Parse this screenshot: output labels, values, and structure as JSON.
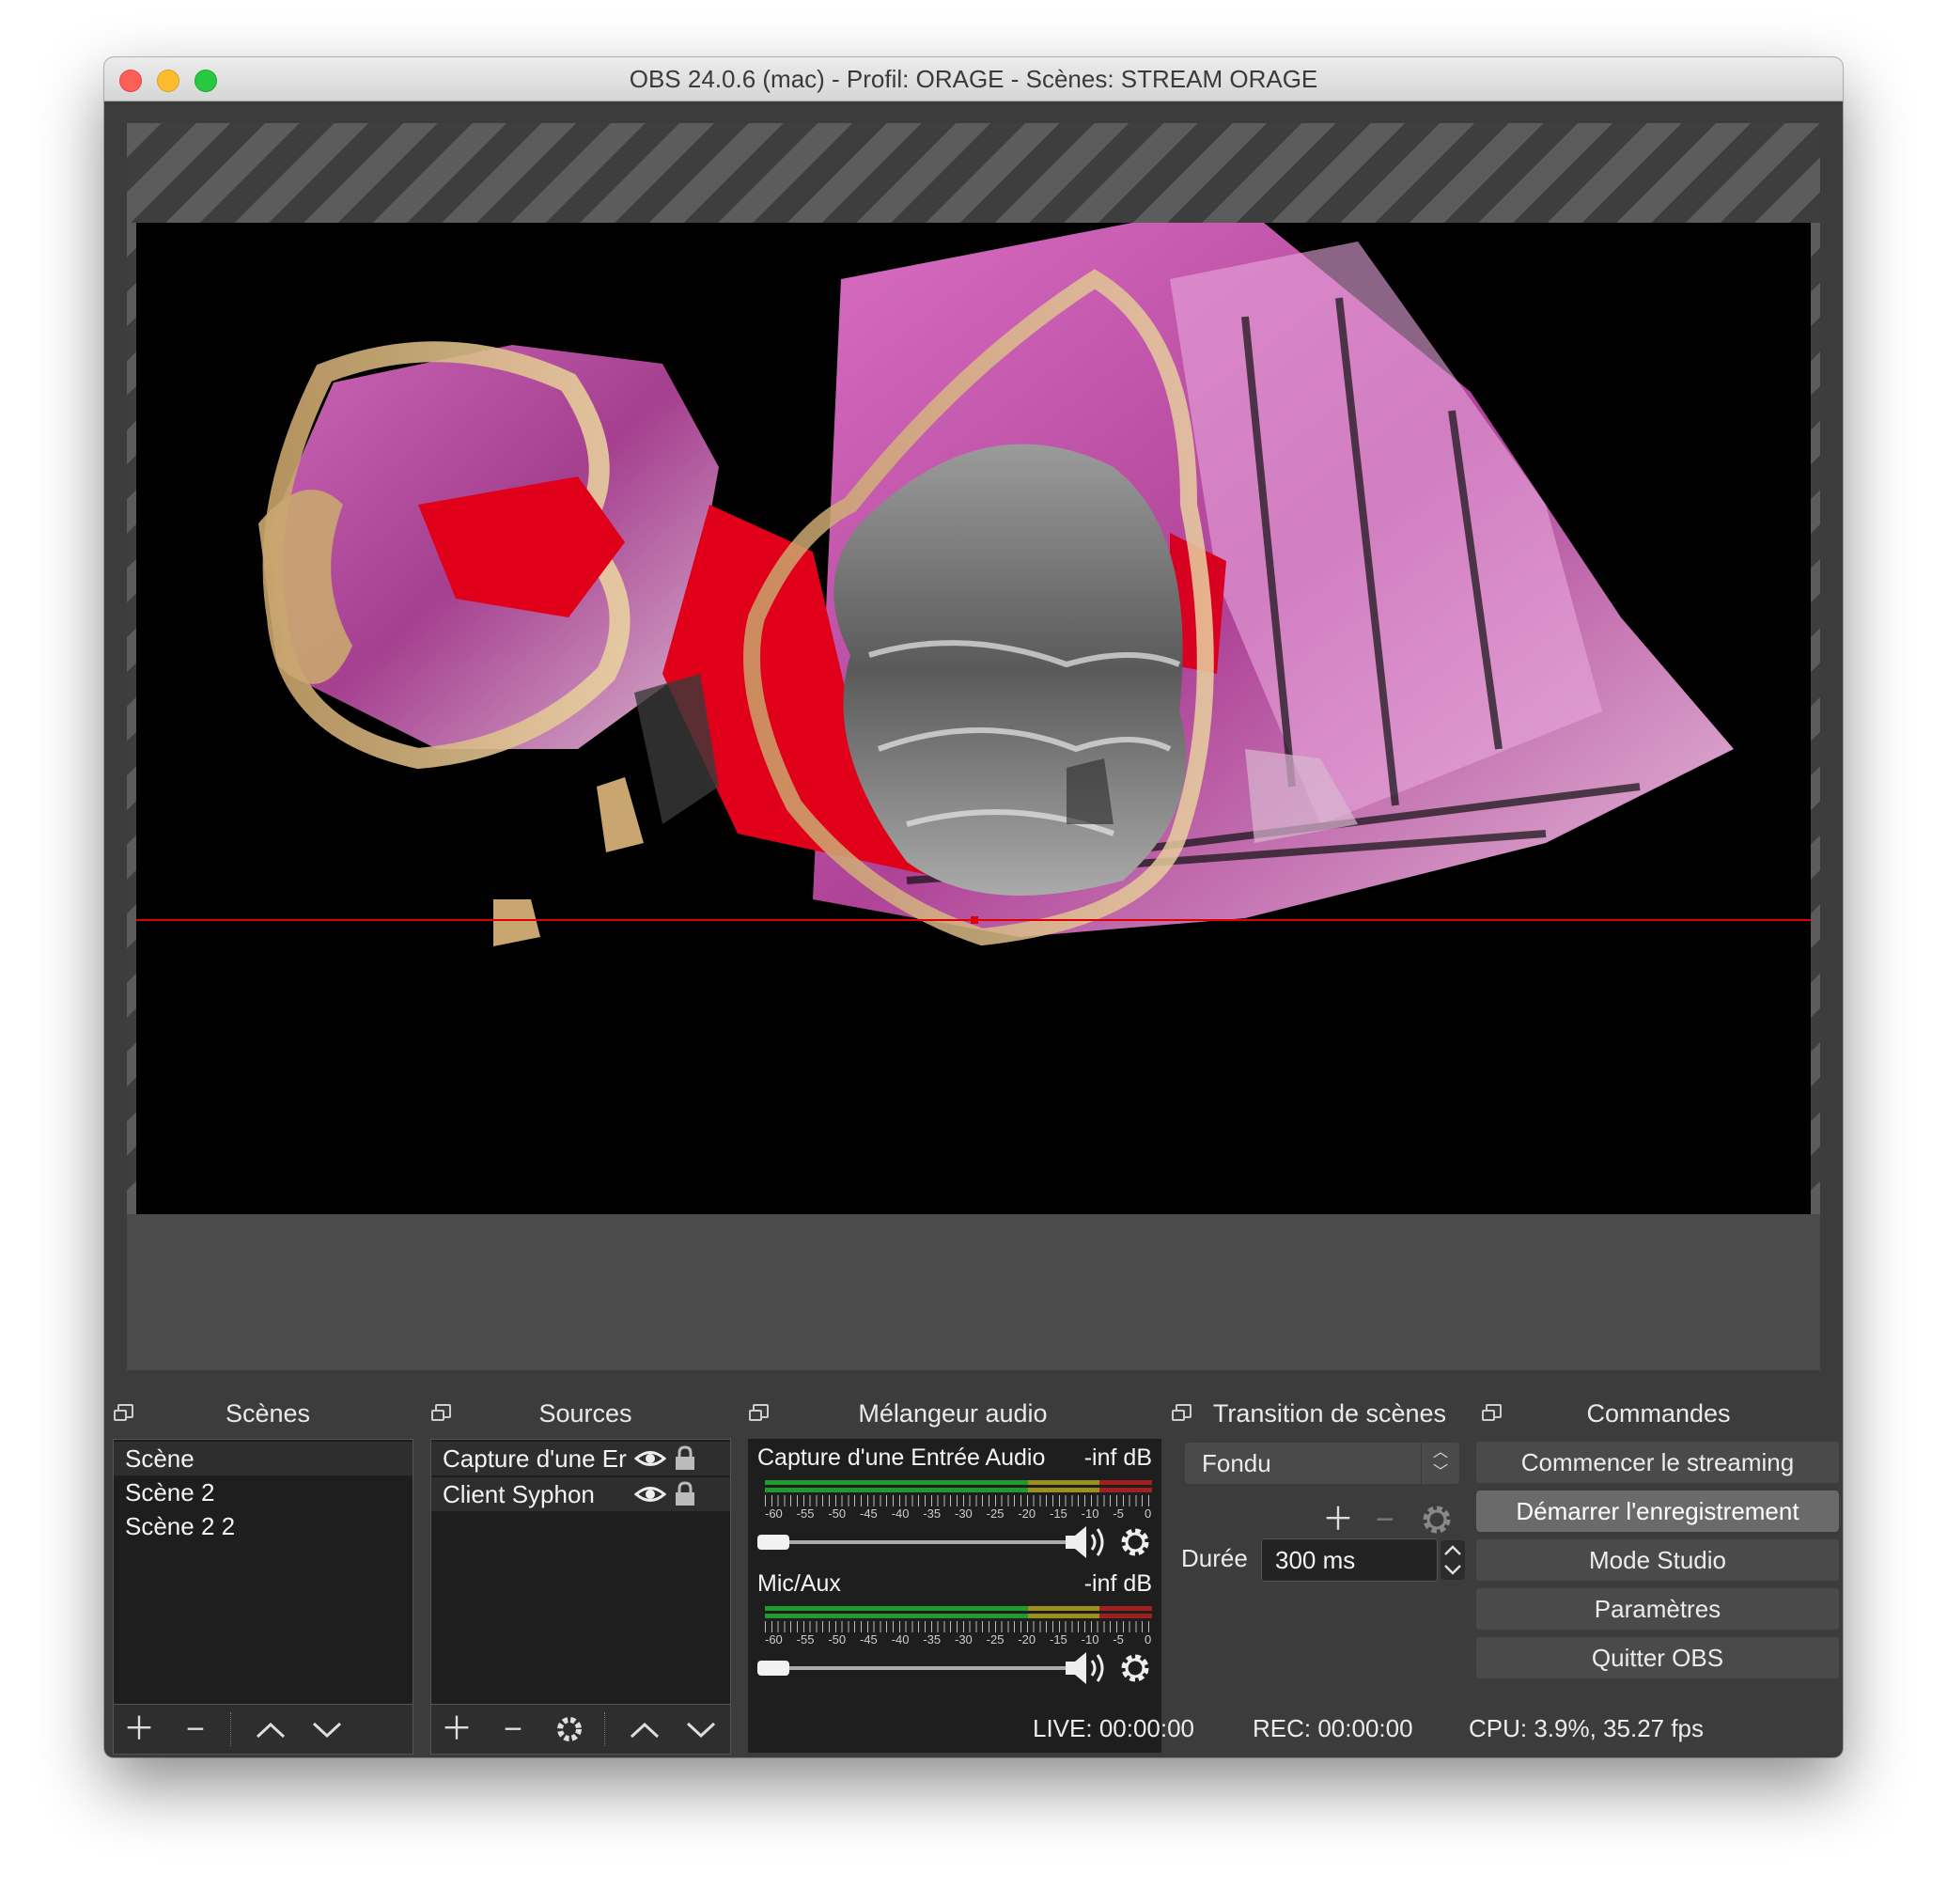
{
  "window": {
    "title": "OBS 24.0.6 (mac) - Profil: ORAGE - Scènes: STREAM ORAGE"
  },
  "docks": {
    "scenes": "Scènes",
    "sources": "Sources",
    "mixer": "Mélangeur audio",
    "transition": "Transition de scènes",
    "controls": "Commandes"
  },
  "scenes": {
    "items": [
      {
        "label": "Scène"
      },
      {
        "label": "Scène 2"
      },
      {
        "label": "Scène 2 2"
      }
    ]
  },
  "sources": {
    "items": [
      {
        "label": "Capture d'une Er"
      },
      {
        "label": "Client Syphon"
      }
    ]
  },
  "mixer": {
    "channels": [
      {
        "name": "Capture d'une Entrée Audio",
        "level": "-inf dB",
        "volume": 0.0
      },
      {
        "name": "Mic/Aux",
        "level": "-inf dB",
        "volume": 0.0
      }
    ],
    "scale": [
      "-60",
      "-55",
      "-50",
      "-45",
      "-40",
      "-35",
      "-30",
      "-25",
      "-20",
      "-15",
      "-10",
      "-5",
      "0"
    ]
  },
  "transition": {
    "selected": "Fondu",
    "duration_label": "Durée",
    "duration_value": "300 ms"
  },
  "controls": {
    "buttons": [
      "Commencer le streaming",
      "Démarrer l'enregistrement",
      "Mode Studio",
      "Paramètres",
      "Quitter OBS"
    ]
  },
  "status": {
    "live": "LIVE: 00:00:00",
    "rec": "REC: 00:00:00",
    "cpu": "CPU: 3.9%, 35.27 fps"
  },
  "colors": {
    "window_bg": "#3c3c3c",
    "panel_bg": "#1e1e1e",
    "guide_red": "#e00000",
    "meter_green": "#1f9a2c",
    "meter_yellow": "#9a8f1f",
    "meter_red": "#a02020"
  }
}
